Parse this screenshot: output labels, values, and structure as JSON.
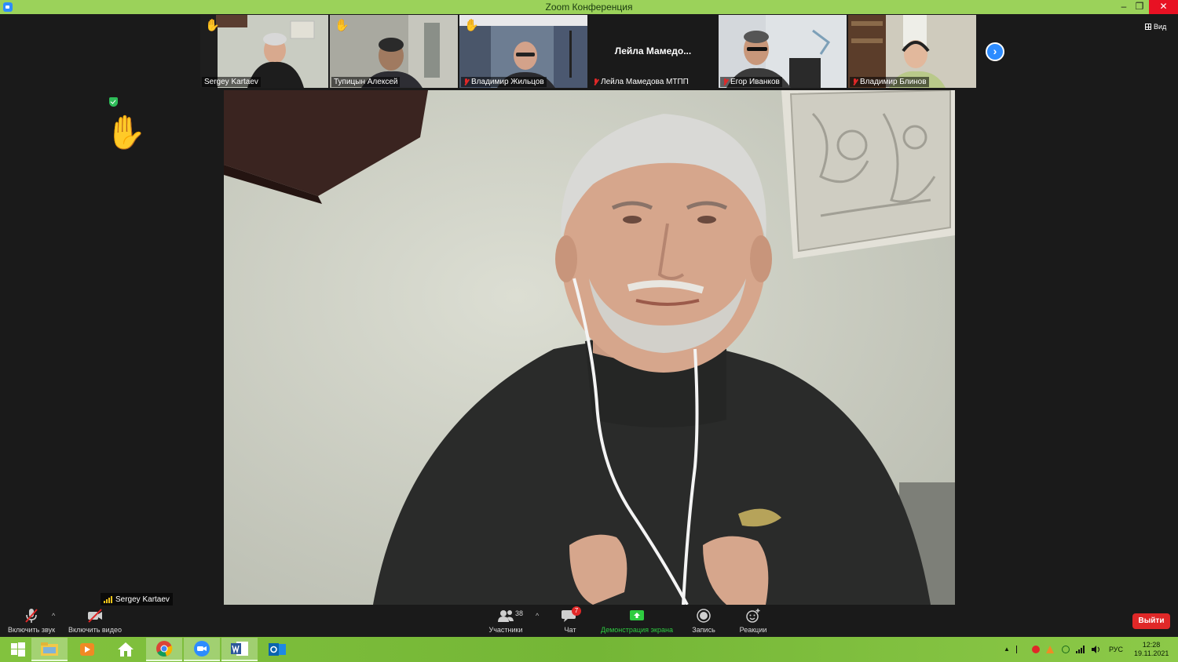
{
  "window": {
    "title": "Zoom Конференция",
    "min": "–",
    "max": "❐",
    "close": "✕"
  },
  "view_button": {
    "label": "Вид"
  },
  "thumbnails": [
    {
      "name": "Sergey Kartaev",
      "hand_raised": true,
      "muted": false,
      "active": true
    },
    {
      "name": "Тупицын Алексей",
      "hand_raised": true,
      "muted": false,
      "active": false
    },
    {
      "name": "Владимир Жильцов",
      "hand_raised": true,
      "muted": true,
      "active": false
    },
    {
      "name": "Лейла Мамедова МТПП",
      "display_text": "Лейла  Мамедо...",
      "hand_raised": false,
      "muted": true,
      "active": false,
      "video_off": true
    },
    {
      "name": "Егор Иванков",
      "hand_raised": false,
      "muted": true,
      "active": false
    },
    {
      "name": "Владимир Блинов",
      "hand_raised": false,
      "muted": true,
      "active": false
    }
  ],
  "next_page": {
    "label": "›"
  },
  "active_speaker": {
    "name": "Sergey Kartaev"
  },
  "toolbar": {
    "unmute": "Включить звук",
    "start_video": "Включить видео",
    "participants_label": "Участники",
    "participants_count": "38",
    "chat_label": "Чат",
    "chat_badge": "7",
    "share_label": "Демонстрация экрана",
    "record_label": "Запись",
    "reactions_label": "Реакции",
    "leave": "Выйти",
    "caret": "^"
  },
  "taskbar": {
    "language": "РУС",
    "time": "12:28",
    "date": "19.11.2021"
  },
  "colors": {
    "titlebar": "#9bd25a",
    "accent": "#2d8cff",
    "leave": "#e02828",
    "share": "#2ecc40",
    "hand": "#f5c518"
  }
}
